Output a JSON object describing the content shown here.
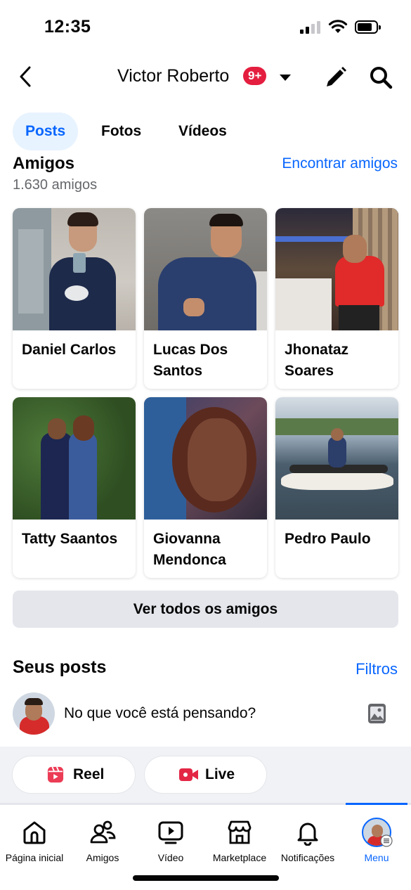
{
  "status_bar": {
    "time": "12:35"
  },
  "header": {
    "title": "Victor Roberto",
    "badge": "9+"
  },
  "tabs": [
    {
      "label": "Posts",
      "active": true
    },
    {
      "label": "Fotos",
      "active": false
    },
    {
      "label": "Vídeos",
      "active": false
    }
  ],
  "friends": {
    "title": "Amigos",
    "count": "1.630 amigos",
    "find_link": "Encontrar amigos",
    "items": [
      {
        "name": "Daniel Carlos"
      },
      {
        "name": "Lucas Dos Santos"
      },
      {
        "name": "Jhonataz Soares"
      },
      {
        "name": "Tatty Saantos"
      },
      {
        "name": "Giovanna Mendonca"
      },
      {
        "name": "Pedro Paulo"
      }
    ],
    "see_all": "Ver todos os amigos"
  },
  "posts": {
    "title": "Seus posts",
    "filters": "Filtros",
    "composer_placeholder": "No que você está pensando?",
    "reel_label": "Reel",
    "live_label": "Live"
  },
  "bottom_nav": [
    {
      "label": "Página inicial",
      "icon": "home-icon"
    },
    {
      "label": "Amigos",
      "icon": "friends-icon"
    },
    {
      "label": "Vídeo",
      "icon": "video-icon"
    },
    {
      "label": "Marketplace",
      "icon": "marketplace-icon"
    },
    {
      "label": "Notificações",
      "icon": "bell-icon"
    },
    {
      "label": "Menu",
      "icon": "menu-avatar",
      "active": true
    }
  ],
  "colors": {
    "accent": "#0866ff",
    "badge": "#e41e3f",
    "strip": "#f0f2f5"
  }
}
